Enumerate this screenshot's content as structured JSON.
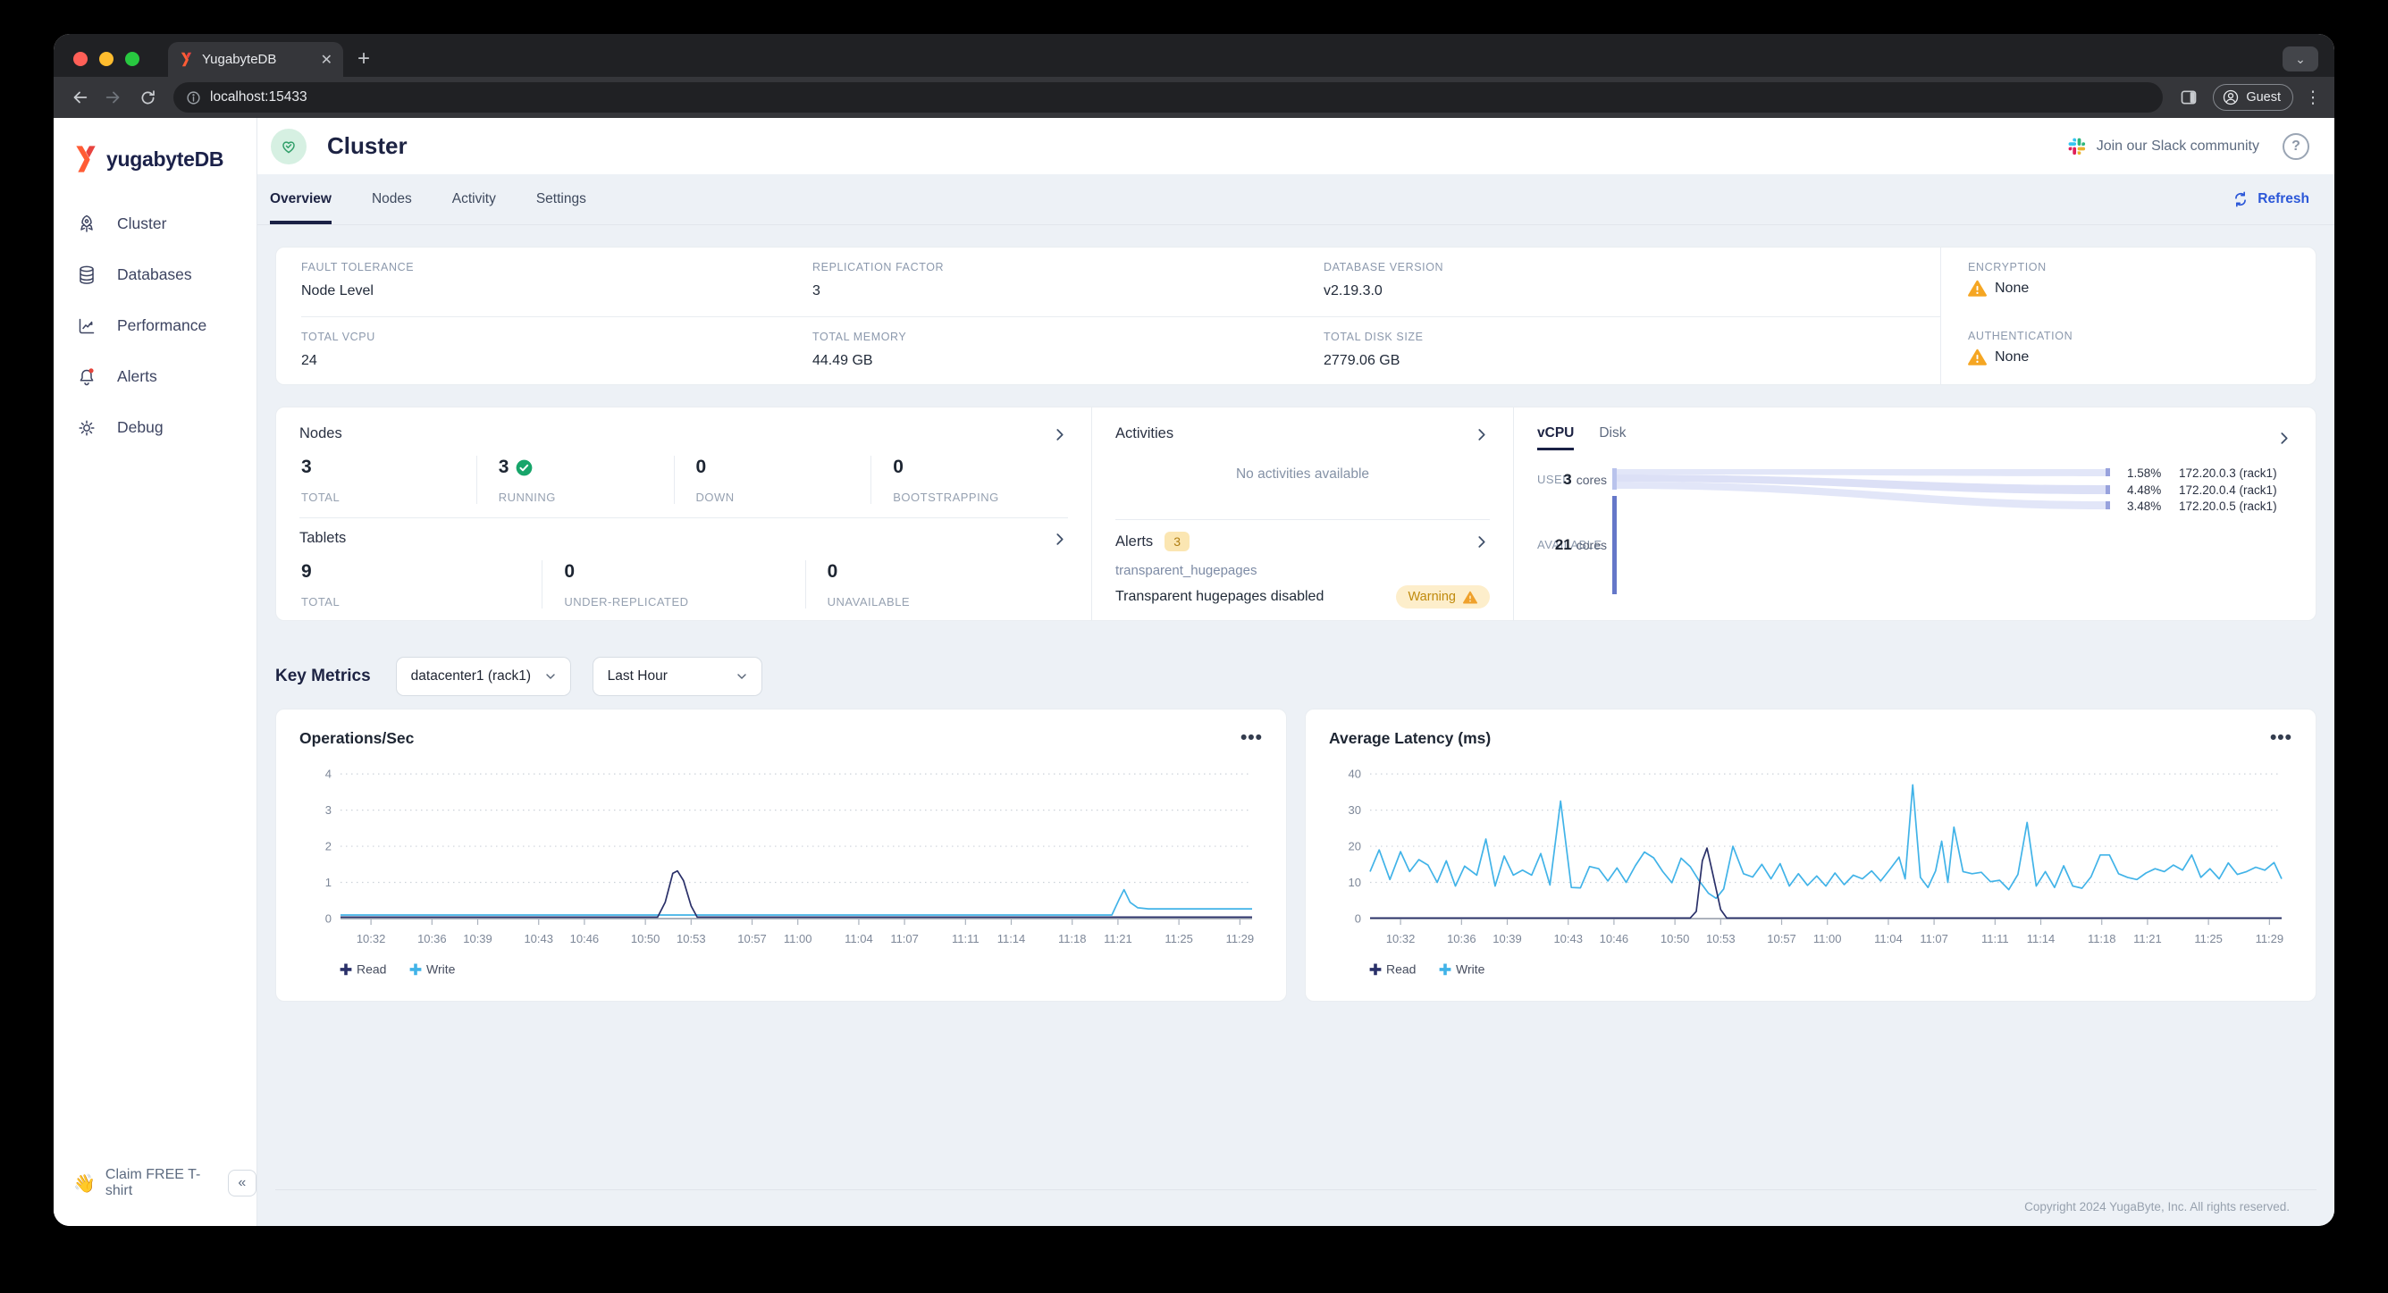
{
  "browser": {
    "tab_title": "YugabyteDB",
    "url": "localhost:15433",
    "guest_label": "Guest"
  },
  "sidebar": {
    "logo_text": "yugabyteDB",
    "items": [
      {
        "label": "Cluster",
        "icon": "rocket-icon"
      },
      {
        "label": "Databases",
        "icon": "database-icon"
      },
      {
        "label": "Performance",
        "icon": "performance-icon"
      },
      {
        "label": "Alerts",
        "icon": "bell-icon",
        "has_dot": true
      },
      {
        "label": "Debug",
        "icon": "gear-icon"
      }
    ],
    "claim": {
      "emoji": "👋",
      "label": "Claim FREE T-shirt",
      "collapse": "«"
    }
  },
  "header": {
    "title": "Cluster",
    "slack_label": "Join our Slack community",
    "help_label": "?",
    "tabs": [
      {
        "label": "Overview"
      },
      {
        "label": "Nodes"
      },
      {
        "label": "Activity"
      },
      {
        "label": "Settings"
      }
    ],
    "refresh_label": "Refresh"
  },
  "overview_panel": {
    "fields": [
      {
        "label": "FAULT TOLERANCE",
        "value": "Node Level"
      },
      {
        "label": "REPLICATION FACTOR",
        "value": "3"
      },
      {
        "label": "DATABASE VERSION",
        "value": "v2.19.3.0"
      },
      {
        "label": "TOTAL VCPU",
        "value": "24"
      },
      {
        "label": "TOTAL MEMORY",
        "value": "44.49 GB"
      },
      {
        "label": "TOTAL DISK SIZE",
        "value": "2779.06 GB"
      }
    ],
    "security": [
      {
        "label": "ENCRYPTION",
        "value": "None"
      },
      {
        "label": "AUTHENTICATION",
        "value": "None"
      }
    ]
  },
  "cards": {
    "nodes": {
      "title": "Nodes",
      "stats": [
        {
          "value": "3",
          "label": "TOTAL"
        },
        {
          "value": "3",
          "label": "RUNNING"
        },
        {
          "value": "0",
          "label": "DOWN"
        },
        {
          "value": "0",
          "label": "BOOTSTRAPPING"
        }
      ]
    },
    "tablets": {
      "title": "Tablets",
      "stats": [
        {
          "value": "9",
          "label": "TOTAL"
        },
        {
          "value": "0",
          "label": "UNDER-REPLICATED"
        },
        {
          "value": "0",
          "label": "UNAVAILABLE"
        }
      ]
    },
    "activities": {
      "title": "Activities",
      "empty_text": "No activities available"
    },
    "alerts": {
      "title": "Alerts",
      "count": "3",
      "alert_name": "transparent_hugepages",
      "alert_message": "Transparent hugepages disabled",
      "severity": "Warning"
    },
    "vcpu": {
      "tabs": [
        {
          "label": "vCPU"
        },
        {
          "label": "Disk"
        }
      ],
      "used_label": "USED",
      "used_value": "3",
      "used_unit": "cores",
      "available_label": "AVAILABLE",
      "available_value": "21",
      "available_unit": "cores",
      "nodes": [
        {
          "pct": "1.58%",
          "node": "172.20.0.3 (rack1)"
        },
        {
          "pct": "4.48%",
          "node": "172.20.0.4 (rack1)"
        },
        {
          "pct": "3.48%",
          "node": "172.20.0.5 (rack1)"
        }
      ]
    }
  },
  "key_metrics": {
    "title": "Key Metrics",
    "region": "datacenter1 (rack1)",
    "range": "Last Hour"
  },
  "footer": {
    "copyright": "Copyright 2024 YugaByte, Inc. All rights reserved."
  },
  "colors": {
    "accent_blue": "#2b57d8",
    "brand_navy": "#1b2149",
    "warning_orange": "#f5a623",
    "success_green": "#17a56a",
    "read_line": "#2a3069",
    "write_line": "#41b3e8"
  },
  "chart_data": [
    {
      "type": "line",
      "title": "Operations/Sec",
      "xlabel": "",
      "ylabel": "",
      "grid": "dotted-horizontal",
      "legend_position": "bottom-left",
      "xlim": [
        -2,
        57.8
      ],
      "ylim": [
        0,
        4.3
      ],
      "yticks": [
        0,
        1,
        2,
        3,
        4
      ],
      "xticks": [
        0,
        4,
        7,
        11,
        14,
        18,
        21,
        25,
        28,
        32,
        35,
        39,
        42,
        46,
        49,
        53,
        57
      ],
      "xticklabels": [
        "10:32",
        "10:36",
        "10:39",
        "10:43",
        "10:46",
        "10:50",
        "10:53",
        "10:57",
        "11:00",
        "11:04",
        "11:07",
        "11:11",
        "11:14",
        "11:18",
        "11:21",
        "11:25",
        "11:29"
      ],
      "series": [
        {
          "name": "Read",
          "color": "#2a3069",
          "points": [
            [
              -2,
              0.04
            ],
            [
              4,
              0.04
            ],
            [
              8,
              0.04
            ],
            [
              12,
              0.04
            ],
            [
              16,
              0.04
            ],
            [
              18.8,
              0.04
            ],
            [
              19.3,
              0.45
            ],
            [
              19.8,
              1.25
            ],
            [
              20.1,
              1.32
            ],
            [
              20.5,
              1.05
            ],
            [
              21,
              0.35
            ],
            [
              21.4,
              0.04
            ],
            [
              24,
              0.04
            ],
            [
              28,
              0.04
            ],
            [
              32,
              0.04
            ],
            [
              36,
              0.04
            ],
            [
              40,
              0.04
            ],
            [
              44,
              0.04
            ],
            [
              48,
              0.04
            ],
            [
              52,
              0.04
            ],
            [
              57.8,
              0.04
            ]
          ]
        },
        {
          "name": "Write",
          "color": "#41b3e8",
          "points": [
            [
              -2,
              0.1
            ],
            [
              8,
              0.1
            ],
            [
              16,
              0.1
            ],
            [
              24,
              0.1
            ],
            [
              32,
              0.1
            ],
            [
              40,
              0.1
            ],
            [
              46,
              0.1
            ],
            [
              48.6,
              0.1
            ],
            [
              49.1,
              0.55
            ],
            [
              49.4,
              0.8
            ],
            [
              49.8,
              0.45
            ],
            [
              50.3,
              0.3
            ],
            [
              51,
              0.27
            ],
            [
              54,
              0.27
            ],
            [
              57.8,
              0.27
            ]
          ]
        }
      ]
    },
    {
      "type": "line",
      "title": "Average Latency (ms)",
      "xlabel": "",
      "ylabel": "",
      "grid": "dotted-horizontal",
      "legend_position": "bottom-left",
      "xlim": [
        -2,
        57.8
      ],
      "ylim": [
        0,
        43
      ],
      "yticks": [
        0,
        10,
        20,
        30,
        40
      ],
      "xticks": [
        0,
        4,
        7,
        11,
        14,
        18,
        21,
        25,
        28,
        32,
        35,
        39,
        42,
        46,
        49,
        53,
        57
      ],
      "xticklabels": [
        "10:32",
        "10:36",
        "10:39",
        "10:43",
        "10:46",
        "10:50",
        "10:53",
        "10:57",
        "11:00",
        "11:04",
        "11:07",
        "11:11",
        "11:14",
        "11:18",
        "11:21",
        "11:25",
        "11:29"
      ],
      "series": [
        {
          "name": "Read",
          "color": "#2a3069",
          "points": [
            [
              -2,
              0.15
            ],
            [
              10,
              0.15
            ],
            [
              19,
              0.15
            ],
            [
              19.4,
              2
            ],
            [
              19.8,
              16
            ],
            [
              20.1,
              19.5
            ],
            [
              20.5,
              12
            ],
            [
              21,
              2.5
            ],
            [
              21.4,
              0.15
            ],
            [
              30,
              0.15
            ],
            [
              45,
              0.15
            ],
            [
              57.8,
              0.15
            ]
          ]
        },
        {
          "name": "Write",
          "color": "#41b3e8",
          "points": [
            [
              -2,
              13
            ],
            [
              -1.4,
              19
            ],
            [
              -0.7,
              10.8
            ],
            [
              0,
              18.5
            ],
            [
              0.6,
              13
            ],
            [
              1.2,
              16.3
            ],
            [
              1.8,
              14.8
            ],
            [
              2.4,
              10
            ],
            [
              3,
              16
            ],
            [
              3.6,
              9
            ],
            [
              4.2,
              14.5
            ],
            [
              5,
              12
            ],
            [
              5.6,
              22
            ],
            [
              6.2,
              9
            ],
            [
              6.8,
              17.3
            ],
            [
              7.4,
              12
            ],
            [
              8,
              13.4
            ],
            [
              8.6,
              12
            ],
            [
              9.2,
              18
            ],
            [
              9.8,
              9.3
            ],
            [
              10.5,
              32.5
            ],
            [
              11.2,
              8.6
            ],
            [
              11.8,
              8.5
            ],
            [
              12.4,
              14.4
            ],
            [
              13,
              13.8
            ],
            [
              13.6,
              10.4
            ],
            [
              14.2,
              14
            ],
            [
              14.8,
              10
            ],
            [
              15.4,
              14.6
            ],
            [
              16,
              18.4
            ],
            [
              16.6,
              16.8
            ],
            [
              17.2,
              13
            ],
            [
              17.8,
              9.9
            ],
            [
              18.4,
              16.7
            ],
            [
              19,
              14.4
            ],
            [
              19.6,
              10.4
            ],
            [
              20.2,
              7
            ],
            [
              20.7,
              5.6
            ],
            [
              21.2,
              8.2
            ],
            [
              21.8,
              20
            ],
            [
              22.5,
              12.4
            ],
            [
              23.1,
              11.5
            ],
            [
              23.7,
              15
            ],
            [
              24.3,
              11
            ],
            [
              24.9,
              15.2
            ],
            [
              25.5,
              9
            ],
            [
              26.1,
              12.4
            ],
            [
              26.7,
              9.2
            ],
            [
              27.3,
              11.8
            ],
            [
              27.9,
              9
            ],
            [
              28.5,
              12.6
            ],
            [
              29.1,
              9.4
            ],
            [
              29.7,
              12
            ],
            [
              30.3,
              11
            ],
            [
              30.9,
              13.2
            ],
            [
              31.5,
              10.4
            ],
            [
              32.1,
              13.6
            ],
            [
              32.7,
              17
            ],
            [
              33.1,
              11
            ],
            [
              33.6,
              37
            ],
            [
              34.1,
              11.4
            ],
            [
              34.6,
              8.6
            ],
            [
              35.1,
              13.2
            ],
            [
              35.5,
              21.4
            ],
            [
              35.9,
              10
            ],
            [
              36.3,
              25.3
            ],
            [
              36.9,
              13
            ],
            [
              37.5,
              12.4
            ],
            [
              38.1,
              12.8
            ],
            [
              38.7,
              10.2
            ],
            [
              39.3,
              10.6
            ],
            [
              39.9,
              8
            ],
            [
              40.5,
              12.2
            ],
            [
              41.1,
              26.6
            ],
            [
              41.7,
              9
            ],
            [
              42.3,
              13
            ],
            [
              42.9,
              8.6
            ],
            [
              43.5,
              14.6
            ],
            [
              44.1,
              9
            ],
            [
              44.7,
              8.4
            ],
            [
              45.3,
              11.6
            ],
            [
              45.9,
              17.6
            ],
            [
              46.5,
              17.6
            ],
            [
              47.1,
              12.4
            ],
            [
              47.7,
              11.4
            ],
            [
              48.3,
              10.8
            ],
            [
              48.9,
              12.6
            ],
            [
              49.5,
              13.8
            ],
            [
              50.1,
              13
            ],
            [
              50.7,
              14.8
            ],
            [
              51.3,
              13.4
            ],
            [
              51.9,
              17.6
            ],
            [
              52.5,
              11.4
            ],
            [
              53.1,
              13.8
            ],
            [
              53.7,
              11
            ],
            [
              54.3,
              15.4
            ],
            [
              54.9,
              12.2
            ],
            [
              55.5,
              13
            ],
            [
              56.1,
              14.2
            ],
            [
              56.7,
              13.4
            ],
            [
              57.3,
              15.5
            ],
            [
              57.8,
              11
            ]
          ]
        }
      ]
    }
  ]
}
